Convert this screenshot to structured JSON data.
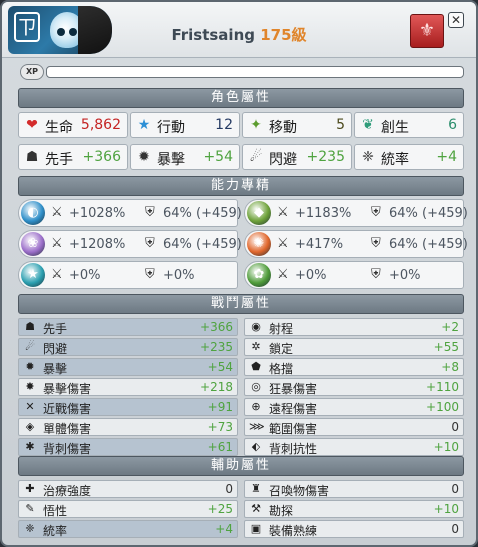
{
  "header": {
    "avatar_glyph": "ㄗ",
    "name": "Fristsaing",
    "level": "175級",
    "guild_icon": "crest-icon",
    "close_label": "✕"
  },
  "xp": {
    "badge": "XP",
    "progress": 0
  },
  "sections": {
    "character": "角色屬性",
    "mastery": "能力專精",
    "combat": "戰鬥屬性",
    "support": "輔助屬性"
  },
  "character": [
    {
      "label": "生命",
      "value": "5,862",
      "icon": "heart-icon",
      "glyph": "❤",
      "color": "#d32b2b"
    },
    {
      "label": "行動",
      "value": "12",
      "icon": "star-icon",
      "glyph": "★",
      "color": "#2b8fd6"
    },
    {
      "label": "移動",
      "value": "5",
      "icon": "boot-icon",
      "glyph": "✦",
      "color": "#5b9c2e"
    },
    {
      "label": "創生",
      "value": "6",
      "icon": "wings-icon",
      "glyph": "❦",
      "color": "#2e9c7a"
    },
    {
      "label": "先手",
      "value": "+366",
      "icon": "initiative-icon",
      "glyph": "☗",
      "color": "#333"
    },
    {
      "label": "暴擊",
      "value": "+54",
      "icon": "critical-icon",
      "glyph": "✹",
      "color": "#333"
    },
    {
      "label": "閃避",
      "value": "+235",
      "icon": "dodge-icon",
      "glyph": "☄",
      "color": "#333"
    },
    {
      "label": "統率",
      "value": "+4",
      "icon": "paw-icon",
      "glyph": "❈",
      "color": "#333"
    }
  ],
  "mastery": [
    {
      "icon": "water-icon",
      "glyph": "◐",
      "color": "#2f8fc9",
      "damage": "+1028%",
      "resist": "64% (+459)"
    },
    {
      "icon": "earth-icon",
      "glyph": "◆",
      "color": "#6ea23a",
      "damage": "+1183%",
      "resist": "64% (+459)"
    },
    {
      "icon": "air-icon",
      "glyph": "❀",
      "color": "#9b6ec9",
      "damage": "+1208%",
      "resist": "64% (+459)"
    },
    {
      "icon": "fire-icon",
      "glyph": "✺",
      "color": "#e0662b",
      "damage": "+417%",
      "resist": "64% (+459)"
    },
    {
      "icon": "stasis-icon",
      "glyph": "★",
      "color": "#2b9fb0",
      "damage": "+0%",
      "resist": "+0%"
    },
    {
      "icon": "light-icon",
      "glyph": "✿",
      "color": "#4f9c3a",
      "damage": "+0%",
      "resist": "+0%"
    }
  ],
  "combat": [
    {
      "label": "先手",
      "value": "+366",
      "icon": "initiative-icon",
      "glyph": "☗"
    },
    {
      "label": "射程",
      "value": "+2",
      "icon": "range-icon",
      "glyph": "◉"
    },
    {
      "label": "閃避",
      "value": "+235",
      "icon": "dodge-icon",
      "glyph": "☄"
    },
    {
      "label": "鎖定",
      "value": "+55",
      "icon": "lock-icon",
      "glyph": "✲"
    },
    {
      "label": "暴擊",
      "value": "+54",
      "icon": "critical-icon",
      "glyph": "✹"
    },
    {
      "label": "格擋",
      "value": "+8",
      "icon": "block-icon",
      "glyph": "⬟"
    },
    {
      "label": "暴擊傷害",
      "value": "+218",
      "icon": "crit-damage-icon",
      "glyph": "✸"
    },
    {
      "label": "狂暴傷害",
      "value": "+110",
      "icon": "berserk-icon",
      "glyph": "◎"
    },
    {
      "label": "近戰傷害",
      "value": "+91",
      "icon": "melee-icon",
      "glyph": "✕"
    },
    {
      "label": "遠程傷害",
      "value": "+100",
      "icon": "ranged-icon",
      "glyph": "⊕"
    },
    {
      "label": "單體傷害",
      "value": "+73",
      "icon": "single-target-icon",
      "glyph": "◈"
    },
    {
      "label": "範圍傷害",
      "value": "0",
      "icon": "area-icon",
      "glyph": "⋙"
    },
    {
      "label": "背刺傷害",
      "value": "+61",
      "icon": "backstab-icon",
      "glyph": "✱"
    },
    {
      "label": "背刺抗性",
      "value": "+10",
      "icon": "backstab-resist-icon",
      "glyph": "⬖"
    }
  ],
  "support": [
    {
      "label": "治療強度",
      "value": "0",
      "icon": "heal-icon",
      "glyph": "✚"
    },
    {
      "label": "召喚物傷害",
      "value": "0",
      "icon": "summon-icon",
      "glyph": "♜"
    },
    {
      "label": "悟性",
      "value": "+25",
      "icon": "wisdom-icon",
      "glyph": "✎"
    },
    {
      "label": "勘探",
      "value": "+10",
      "icon": "prospecting-icon",
      "glyph": "⚒"
    },
    {
      "label": "統率",
      "value": "+4",
      "icon": "paw-icon",
      "glyph": "❈"
    },
    {
      "label": "裝備熟練",
      "value": "0",
      "icon": "equipment-icon",
      "glyph": "▣"
    }
  ],
  "glyphs": {
    "sword": "⚔",
    "shield": "⛨"
  }
}
